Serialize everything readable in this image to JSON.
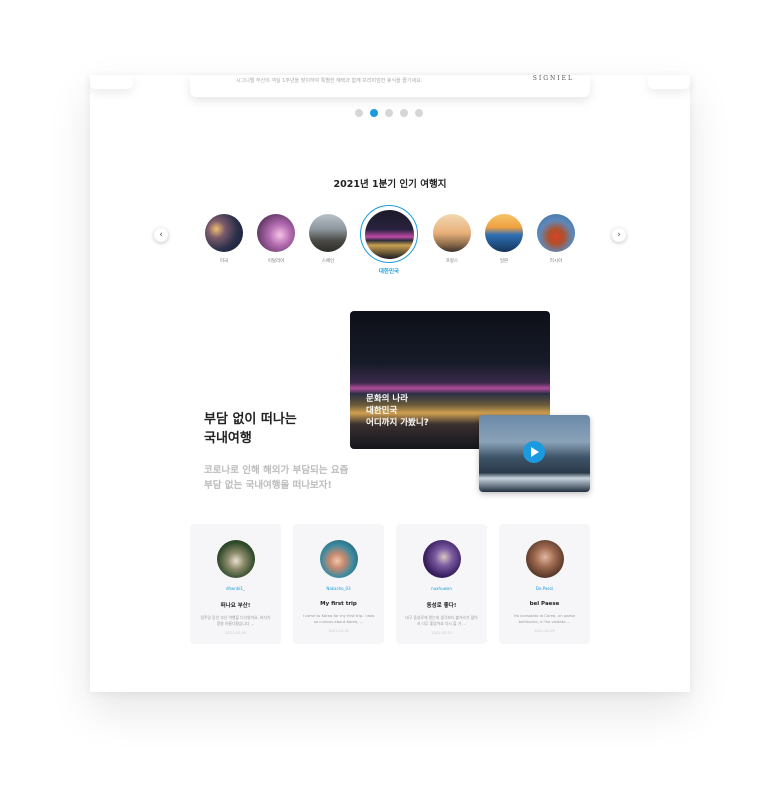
{
  "banner": {
    "text": "시그니엘 부산의 객실 1주년을 맞이하여 특별한 혜택과 함께 프리미엄한 휴식을 즐기세요.",
    "brand": "SIGNIEL"
  },
  "carousel": {
    "total_dots": 5,
    "active_index": 1
  },
  "popular": {
    "title": "2021년 1분기 인기 여행지",
    "prev_label": "‹",
    "next_label": "›",
    "destinations": [
      {
        "label": "미국"
      },
      {
        "label": "이탈리아"
      },
      {
        "label": "스페인"
      },
      {
        "label": "대한민국",
        "active": true
      },
      {
        "label": "프랑스"
      },
      {
        "label": "일본"
      },
      {
        "label": "러시아"
      }
    ]
  },
  "promo": {
    "title_line1": "부담 없이 떠나는",
    "title_line2": "국내여행",
    "sub_line1": "코로나로 인해 해외가 부담되는 요즘",
    "sub_line2": "부담 없는 국내여행을 떠나보자!",
    "photo_line1": "문화의 나라",
    "photo_line2": "대한민국",
    "photo_line3": "어디까지 가봤니?"
  },
  "reviews": [
    {
      "user": "dhwnbl1_",
      "title": "떠나요 부산!",
      "body": "일주일 동안 부산 여행을 다녀왔어요. 바다가 정말 아름다웠습니다 ...",
      "date": "2021-03-18"
    },
    {
      "user": "Nakasho_03",
      "title": "My first trip",
      "body": "I came to Korea for my first trip. I was so curious about Korea, ...",
      "date": "2021-03-16"
    },
    {
      "user": "nuxhuwon",
      "title": "동성로 좋다!",
      "body": "대구 동성로에 왔는데 생각보다 볼거리가 많아서 너무 좋았어요 다시 올 거 ...",
      "date": "2021-03-12"
    },
    {
      "user": "De.Paezi",
      "title": "bel Paese",
      "body": "Ho consolato la Corea, un paese bellissimo, e l'ho visitato ...",
      "date": "2021-03-09"
    }
  ],
  "colors": {
    "accent": "#1a9be0",
    "dot_inactive": "#d6d6d6",
    "card_bg": "#f6f6f8"
  }
}
